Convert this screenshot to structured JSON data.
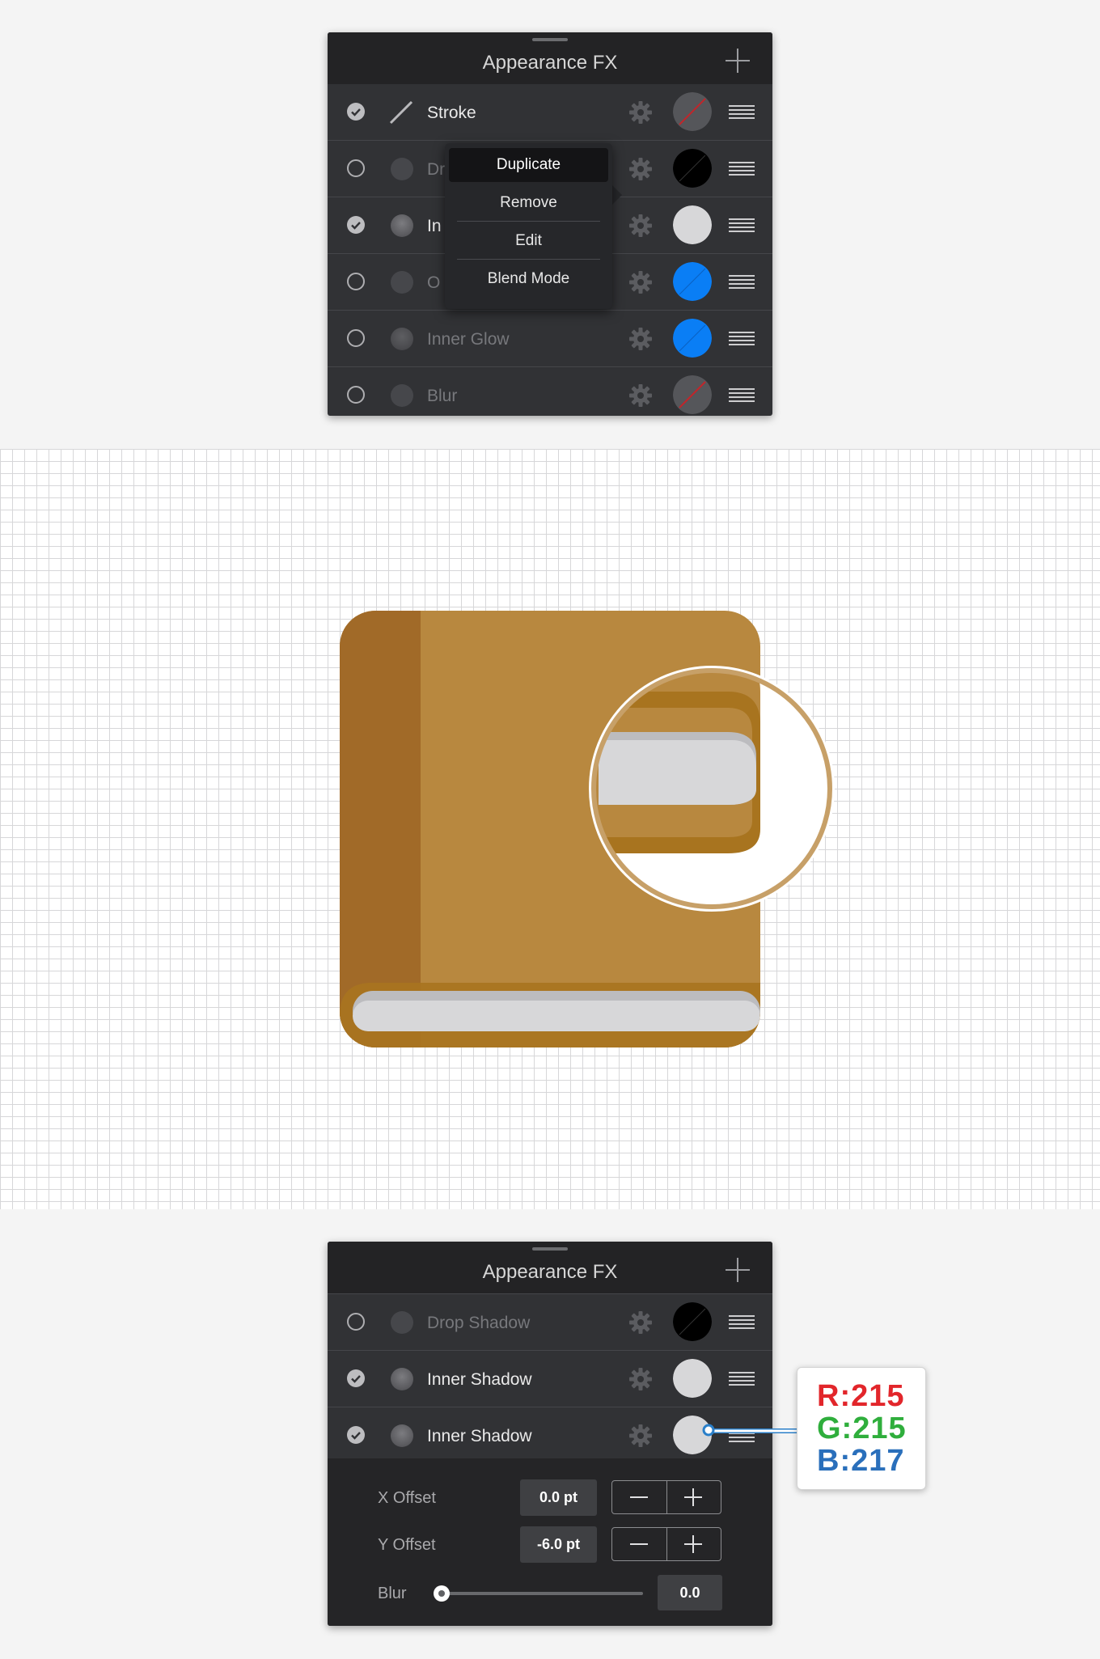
{
  "panel_top": {
    "title": "Appearance FX",
    "rows": [
      {
        "label": "Stroke",
        "enabled": true,
        "icon": "stroke-line-icon",
        "swatch": "none"
      },
      {
        "label": "Dr",
        "enabled": false,
        "icon": "dot-icon",
        "swatch": "#000000"
      },
      {
        "label": "In",
        "enabled": true,
        "icon": "dot-icon",
        "swatch": "#d7d7d9"
      },
      {
        "label": "O",
        "enabled": false,
        "icon": "dot-icon",
        "swatch": "#0a7ef5"
      },
      {
        "label": "Inner Glow",
        "enabled": false,
        "icon": "dot-icon",
        "swatch": "#0a7ef5"
      },
      {
        "label": "Blur",
        "enabled": false,
        "icon": "dot-icon",
        "swatch": "none"
      }
    ],
    "context_menu": {
      "items": [
        "Duplicate",
        "Remove",
        "Edit",
        "Blend Mode"
      ],
      "selected": "Duplicate"
    }
  },
  "panel_bottom": {
    "title": "Appearance FX",
    "rows": [
      {
        "label": "Drop Shadow",
        "enabled": false,
        "swatch": "#000000"
      },
      {
        "label": "Inner Shadow",
        "enabled": true,
        "swatch": "#d7d7d9"
      },
      {
        "label": "Inner Shadow",
        "enabled": true,
        "swatch": "#d7d7d9"
      }
    ],
    "settings": {
      "x_offset_label": "X Offset",
      "x_offset_value": "0.0 pt",
      "y_offset_label": "Y Offset",
      "y_offset_value": "-6.0 pt",
      "blur_label": "Blur",
      "blur_value": "0.0",
      "blur_level": 0
    }
  },
  "color_callout": {
    "r": "R:215",
    "g": "G:215",
    "b": "B:217"
  },
  "colors": {
    "book_cover": "#b8883f",
    "book_spine": "#a16a28",
    "pages": "#d7d7d9",
    "accent_blue": "#0a7ef5",
    "panel_bg": "#313235"
  }
}
